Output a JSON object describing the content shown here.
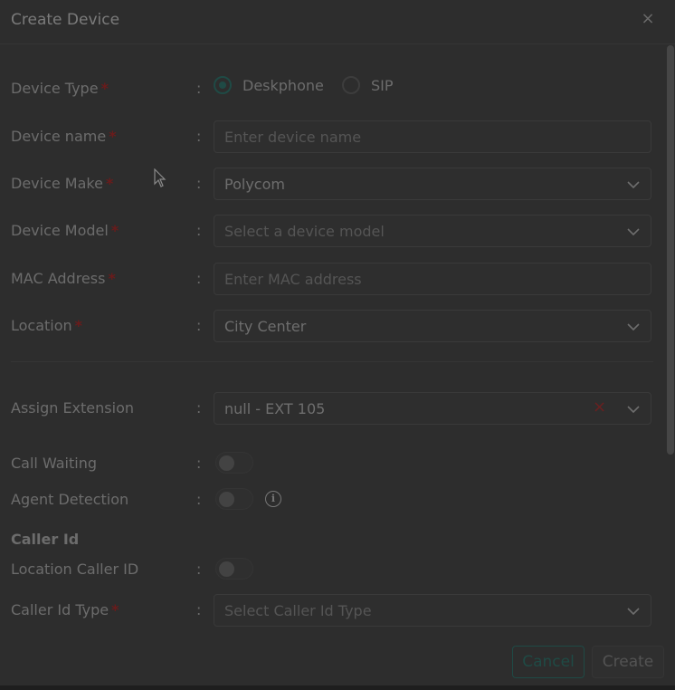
{
  "dialog": {
    "title": "Create Device",
    "close_symbol": "×",
    "colon": ":"
  },
  "form": {
    "device_type": {
      "label": "Device Type",
      "options": [
        {
          "label": "Deskphone",
          "selected": true
        },
        {
          "label": "SIP",
          "selected": false
        }
      ]
    },
    "device_name": {
      "label": "Device name",
      "placeholder": "Enter device name"
    },
    "device_make": {
      "label": "Device Make",
      "value": "Polycom"
    },
    "device_model": {
      "label": "Device Model",
      "placeholder": "Select a device model"
    },
    "mac_address": {
      "label": "MAC Address",
      "placeholder": "Enter MAC address"
    },
    "location": {
      "label": "Location",
      "value": "City Center"
    },
    "assign_extension": {
      "label": "Assign Extension",
      "value": "null - EXT 105",
      "clear_symbol": "×"
    },
    "call_waiting": {
      "label": "Call Waiting",
      "on": false
    },
    "agent_detection": {
      "label": "Agent Detection",
      "on": false,
      "info_symbol": "i"
    },
    "caller_id_section": "Caller Id",
    "location_caller_id": {
      "label": "Location Caller ID",
      "on": false
    },
    "caller_id_type": {
      "label": "Caller Id Type",
      "placeholder": "Select Caller Id Type"
    },
    "required_marker": "*"
  },
  "footer": {
    "cancel_label": "Cancel",
    "create_label": "Create"
  },
  "colors": {
    "accent": "#1f4a45",
    "required": "#6b1b1b",
    "background": "#2d2d2d"
  }
}
